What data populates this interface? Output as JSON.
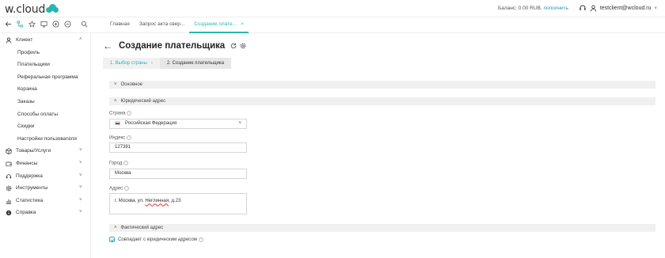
{
  "brand": {
    "logo_text": "w.cloud",
    "accent": "#2ab6b0",
    "link_color": "#2a8fbd"
  },
  "header": {
    "balance_label": "Баланс: 0.00 RUB,",
    "balance_link": "пополнить",
    "user": "testclient@wcloud.ru"
  },
  "toolbar": {
    "icons": [
      "back-icon",
      "sitemap-icon",
      "star-icon",
      "monitor-icon",
      "add-circle-icon",
      "minus-circle-icon",
      "search-icon"
    ],
    "tabs": [
      {
        "label": "Главная",
        "active": false
      },
      {
        "label": "Запрос акта свер...",
        "active": false
      },
      {
        "label": "Создание плате...",
        "active": true,
        "close": "×"
      }
    ]
  },
  "sidebar": {
    "client": {
      "label": "Клиент",
      "chevron": "˄"
    },
    "sub_items": [
      "Профиль",
      "Плательщики",
      "Реферальная программа",
      "Корзина",
      "Заказы",
      "Способы оплаты",
      "Скидки",
      "Настройки пользователя"
    ],
    "groups": [
      {
        "label": "Товары/Услуги",
        "icon": "box-icon"
      },
      {
        "label": "Финансы",
        "icon": "wallet-icon"
      },
      {
        "label": "Поддержка",
        "icon": "support-icon"
      },
      {
        "label": "Инструменты",
        "icon": "gear-icon"
      },
      {
        "label": "Статистика",
        "icon": "chart-icon"
      },
      {
        "label": "Справка",
        "icon": "info-icon"
      }
    ]
  },
  "main": {
    "title": "Создание плательщика",
    "steps": [
      {
        "label": "1. Выбор страны",
        "sep": "›"
      },
      {
        "label": "2. Создание плательщика"
      }
    ],
    "sections": {
      "basic": "Основное",
      "legal_address": "Юридический адрес",
      "actual_address": "Фактический адрес"
    },
    "fields": {
      "country": {
        "label": "Страна",
        "value": "Российская Федерация"
      },
      "index": {
        "label": "Индекс",
        "value": "127381"
      },
      "city": {
        "label": "Город",
        "value": "Москва"
      },
      "address": {
        "label": "Адрес",
        "value_prefix": "г. Москва, ул. ",
        "value_marked": "Неглинная",
        "value_suffix": ", д.23"
      }
    },
    "same_as_legal": "Совпадает с юридическим адресом"
  }
}
